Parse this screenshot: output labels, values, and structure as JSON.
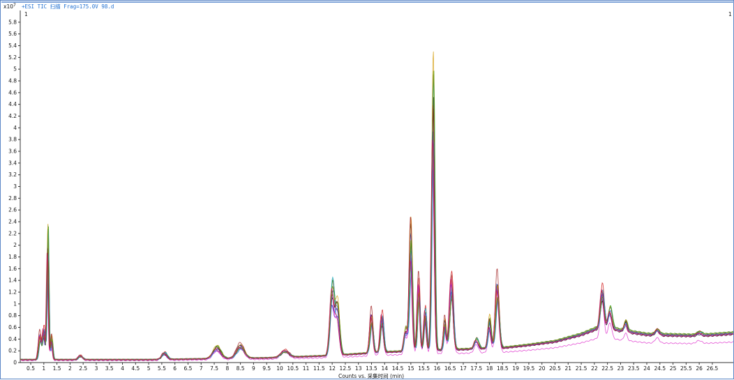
{
  "chart_data": {
    "type": "line",
    "title": "+ESI TIC 扫描 Frag=175.0V 98.d",
    "corner_marker_left": "1",
    "corner_marker_right": "1",
    "y_multiplier": "x10",
    "y_exponent": "7",
    "xlabel": "Counts vs. 采集时间 (min)",
    "ylabel": "",
    "xlim": [
      0.1,
      27.3
    ],
    "ylim": [
      0,
      6.0
    ],
    "x_ticks": [
      0.5,
      1,
      1.5,
      2,
      2.5,
      3,
      3.5,
      4,
      4.5,
      5,
      5.5,
      6,
      6.5,
      7,
      7.5,
      8,
      8.5,
      9,
      9.5,
      10,
      10.5,
      11,
      11.5,
      12,
      12.5,
      13,
      13.5,
      14,
      14.5,
      15,
      15.5,
      16,
      16.5,
      17,
      17.5,
      18,
      18.5,
      19,
      19.5,
      20,
      20.5,
      21,
      21.5,
      22,
      22.5,
      23,
      23.5,
      24,
      24.5,
      25,
      25.5,
      26,
      26.5
    ],
    "x_tick_labels": [
      "0.5",
      "1",
      "1.5",
      "2",
      "2.5",
      "3",
      "3.5",
      "4",
      "4.5",
      "5",
      "5.5",
      "6",
      "6.5",
      "7",
      "7.5",
      "8",
      "8.5",
      "9",
      "9.5",
      "10",
      "10.5",
      "11",
      "11.5",
      "12",
      "12.5",
      "13",
      "13.5",
      "14",
      "14.5",
      "15",
      "15.5",
      "16",
      "16.5",
      "17",
      "17.5",
      "18",
      "18.5",
      "19",
      "19.5",
      "20",
      "20.5",
      "21",
      "21.5",
      "22",
      "22.5",
      "23",
      "23.5",
      "24",
      "24.5",
      "25",
      "25.5",
      "26",
      "26.5"
    ],
    "y_ticks": [
      0,
      0.2,
      0.4,
      0.6,
      0.8,
      1,
      1.2,
      1.4,
      1.6,
      1.8,
      2,
      2.2,
      2.4,
      2.6,
      2.8,
      3,
      3.2,
      3.4,
      3.6,
      3.8,
      4,
      4.2,
      4.4,
      4.6,
      4.8,
      5,
      5.2,
      5.4,
      5.6,
      5.8
    ],
    "y_tick_labels": [
      "0",
      "0.2",
      "0.4",
      "0.6",
      "0.8",
      "1",
      "1.2",
      "1.4",
      "1.6",
      "1.8",
      "2",
      "2.2",
      "2.4",
      "2.6",
      "2.8",
      "3",
      "3.2",
      "3.4",
      "3.6",
      "3.8",
      "4",
      "4.2",
      "4.4",
      "4.6",
      "4.8",
      "5",
      "5.2",
      "5.4",
      "5.6",
      "5.8"
    ],
    "baseline": {
      "x": [
        0.1,
        5.0,
        9.5,
        12.0,
        14.0,
        18.5,
        19.5,
        20.5,
        21.5,
        22.3,
        23.0,
        24.0,
        26.0,
        27.3
      ],
      "y": [
        0.05,
        0.05,
        0.08,
        0.12,
        0.18,
        0.25,
        0.3,
        0.36,
        0.48,
        0.62,
        0.55,
        0.48,
        0.46,
        0.5
      ]
    },
    "peaks": [
      {
        "x": 0.85,
        "h": 0.38,
        "w": 0.05
      },
      {
        "x": 1.0,
        "h": 0.45,
        "w": 0.05
      },
      {
        "x": 1.15,
        "h": 1.95,
        "w": 0.035
      },
      {
        "x": 1.3,
        "h": 0.35,
        "w": 0.04
      },
      {
        "x": 2.4,
        "h": 0.06,
        "w": 0.08
      },
      {
        "x": 5.6,
        "h": 0.1,
        "w": 0.1
      },
      {
        "x": 7.6,
        "h": 0.18,
        "w": 0.15
      },
      {
        "x": 8.5,
        "h": 0.2,
        "w": 0.15
      },
      {
        "x": 10.2,
        "h": 0.1,
        "w": 0.15
      },
      {
        "x": 12.0,
        "h": 1.05,
        "w": 0.08
      },
      {
        "x": 12.2,
        "h": 0.75,
        "w": 0.08
      },
      {
        "x": 13.5,
        "h": 0.6,
        "w": 0.06
      },
      {
        "x": 13.9,
        "h": 0.55,
        "w": 0.06
      },
      {
        "x": 14.8,
        "h": 0.35,
        "w": 0.06
      },
      {
        "x": 15.0,
        "h": 1.85,
        "w": 0.06
      },
      {
        "x": 15.3,
        "h": 1.05,
        "w": 0.05
      },
      {
        "x": 15.55,
        "h": 0.6,
        "w": 0.05
      },
      {
        "x": 15.85,
        "h": 4.1,
        "w": 0.055
      },
      {
        "x": 16.3,
        "h": 0.45,
        "w": 0.05
      },
      {
        "x": 16.55,
        "h": 1.05,
        "w": 0.07
      },
      {
        "x": 17.5,
        "h": 0.15,
        "w": 0.08
      },
      {
        "x": 18.0,
        "h": 0.45,
        "w": 0.06
      },
      {
        "x": 18.3,
        "h": 1.0,
        "w": 0.07
      },
      {
        "x": 22.3,
        "h": 0.55,
        "w": 0.07
      },
      {
        "x": 22.6,
        "h": 0.3,
        "w": 0.07
      },
      {
        "x": 23.2,
        "h": 0.15,
        "w": 0.06
      },
      {
        "x": 24.4,
        "h": 0.08,
        "w": 0.08
      },
      {
        "x": 26.0,
        "h": 0.05,
        "w": 0.1
      }
    ],
    "series": [
      {
        "color": "#d11f1f",
        "scale": 1.12,
        "shift": 0.02,
        "base": 1.02
      },
      {
        "color": "#1b3fd6",
        "scale": 0.95,
        "shift": -0.03,
        "base": 0.98
      },
      {
        "color": "#16a516",
        "scale": 1.02,
        "shift": 0.04,
        "base": 1.04
      },
      {
        "color": "#e03ccf",
        "scale": 0.98,
        "shift": -0.01,
        "base": 0.7
      },
      {
        "color": "#111111",
        "scale": 1.0,
        "shift": 0.0,
        "base": 0.95
      },
      {
        "color": "#1aa6b7",
        "scale": 1.05,
        "shift": 0.03,
        "base": 1.0
      },
      {
        "color": "#8b2ad1",
        "scale": 0.92,
        "shift": -0.04,
        "base": 0.97
      },
      {
        "color": "#d6a21b",
        "scale": 1.08,
        "shift": 0.01,
        "base": 1.03
      },
      {
        "color": "#2f6fe0",
        "scale": 0.9,
        "shift": 0.05,
        "base": 1.01
      },
      {
        "color": "#a52a2a",
        "scale": 1.15,
        "shift": -0.02,
        "base": 0.99
      },
      {
        "color": "#5e8c1a",
        "scale": 0.97,
        "shift": 0.02,
        "base": 1.05
      },
      {
        "color": "#c2185b",
        "scale": 1.01,
        "shift": -0.05,
        "base": 0.96
      }
    ]
  }
}
